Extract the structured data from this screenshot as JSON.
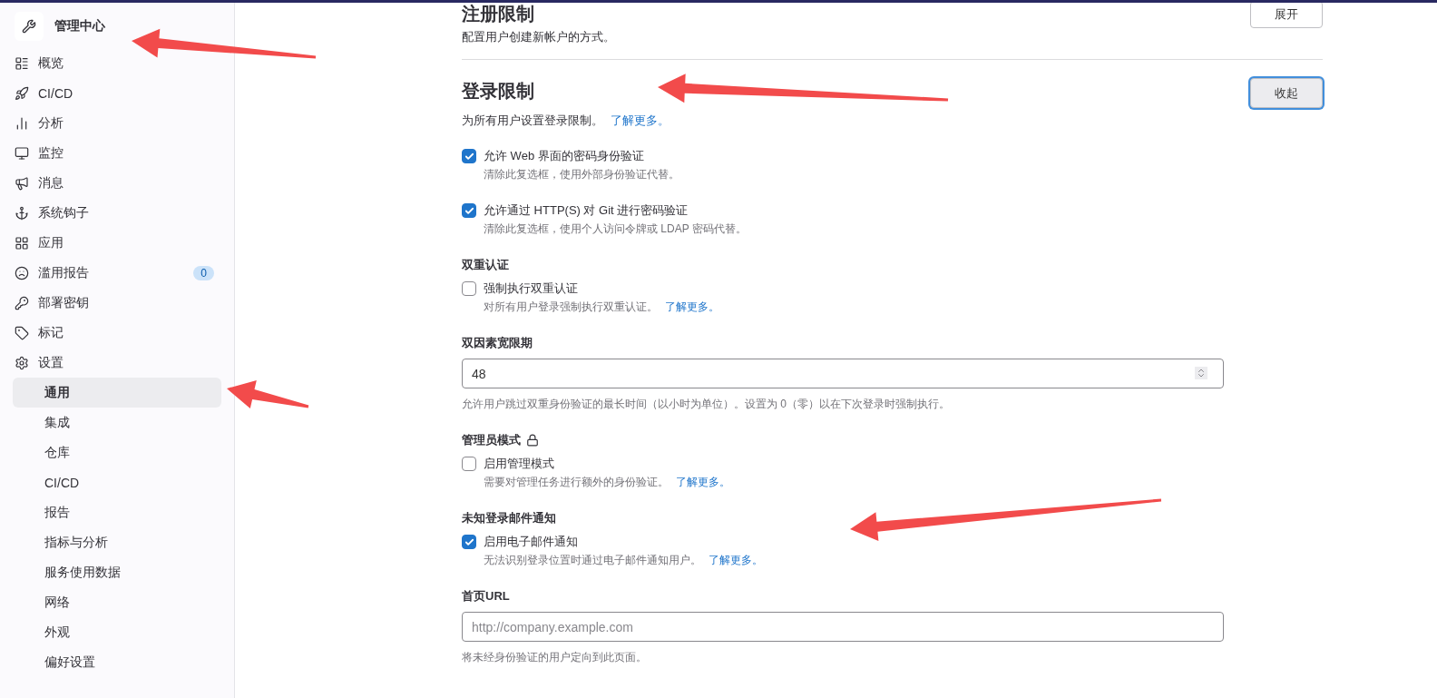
{
  "sidebar": {
    "title": "管理中心",
    "items": [
      {
        "label": "概览",
        "selected": false
      },
      {
        "label": "CI/CD",
        "selected": false
      },
      {
        "label": "分析",
        "selected": false
      },
      {
        "label": "监控",
        "selected": false
      },
      {
        "label": "消息",
        "selected": false
      },
      {
        "label": "系统钩子",
        "selected": false
      },
      {
        "label": "应用",
        "selected": false
      },
      {
        "label": "滥用报告",
        "badge": "0",
        "selected": false
      },
      {
        "label": "部署密钥",
        "selected": false
      },
      {
        "label": "标记",
        "selected": false
      },
      {
        "label": "设置",
        "selected": false,
        "children": [
          {
            "label": "通用",
            "selected": true
          },
          {
            "label": "集成",
            "selected": false
          },
          {
            "label": "仓库",
            "selected": false
          },
          {
            "label": "CI/CD",
            "selected": false
          },
          {
            "label": "报告",
            "selected": false
          },
          {
            "label": "指标与分析",
            "selected": false
          },
          {
            "label": "服务使用数据",
            "selected": false
          },
          {
            "label": "网络",
            "selected": false
          },
          {
            "label": "外观",
            "selected": false
          },
          {
            "label": "偏好设置",
            "selected": false
          }
        ]
      }
    ]
  },
  "sections": [
    {
      "title": "注册限制",
      "description": "配置用户创建新帐户的方式。",
      "button": {
        "label": "展开",
        "focused": false
      }
    },
    {
      "title": "登录限制",
      "description": "为所有用户设置登录限制。",
      "link": "了解更多。",
      "button": {
        "label": "收起",
        "focused": true
      },
      "settings": [
        {
          "kind": "checkbox",
          "label": "允许 Web 界面的密码身份验证",
          "checked": true,
          "help": "清除此复选框，使用外部身份验证代替。"
        },
        {
          "kind": "checkbox",
          "label": "允许通过 HTTP(S) 对 Git 进行密码验证",
          "checked": true,
          "help": "清除此复选框，使用个人访问令牌或 LDAP 密码代替。"
        },
        {
          "kind": "heading",
          "label": "双重认证",
          "locked": false
        },
        {
          "kind": "checkbox",
          "label": "强制执行双重认证",
          "checked": false,
          "help": "对所有用户登录强制执行双重认证。",
          "link": "了解更多。"
        },
        {
          "kind": "heading",
          "label": "双因素宽限期",
          "locked": false
        },
        {
          "kind": "number",
          "value": "48",
          "help": "允许用户跳过双重身份验证的最长时间（以小时为单位）。设置为 0（零）以在下次登录时强制执行。"
        },
        {
          "kind": "heading",
          "label": "管理员模式",
          "locked": true
        },
        {
          "kind": "checkbox",
          "label": "启用管理模式",
          "checked": false,
          "help": "需要对管理任务进行额外的身份验证。",
          "link": "了解更多。"
        },
        {
          "kind": "heading",
          "label": "未知登录邮件通知",
          "locked": false
        },
        {
          "kind": "checkbox",
          "label": "启用电子邮件通知",
          "checked": true,
          "help": "无法识别登录位置时通过电子邮件通知用户。",
          "link": "了解更多。"
        },
        {
          "kind": "heading",
          "label": "首页URL",
          "locked": false
        },
        {
          "kind": "text",
          "placeholder": "http://company.example.com",
          "help": "将未经身份验证的用户定向到此页面。"
        }
      ]
    }
  ],
  "annotations": [
    {
      "kind": "arrow"
    },
    {
      "kind": "arrow"
    },
    {
      "kind": "arrow"
    },
    {
      "kind": "arrow"
    }
  ]
}
